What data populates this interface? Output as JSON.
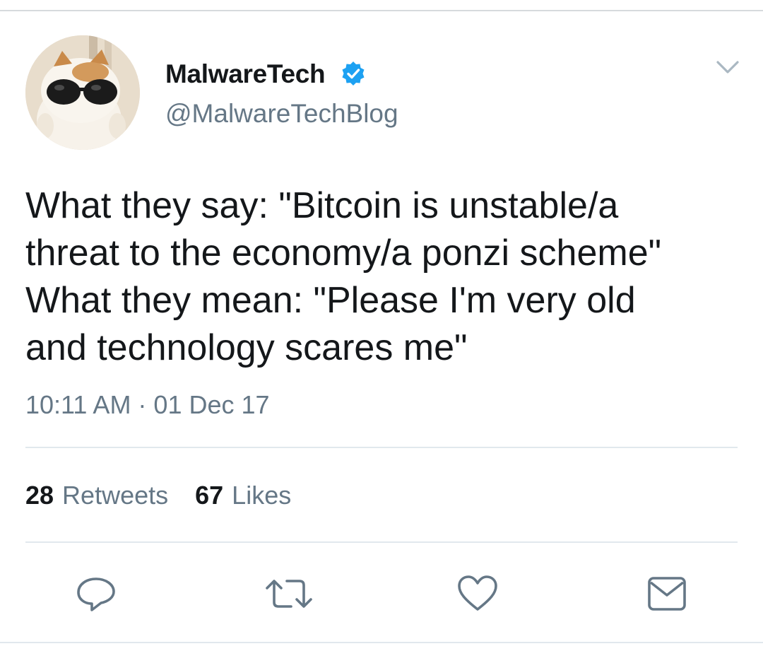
{
  "author": {
    "name": "MalwareTech",
    "handle": "@MalwareTechBlog",
    "verified": true,
    "avatar_icon": "cat-with-sunglasses-avatar"
  },
  "tweet": {
    "text": "What they say: \"Bitcoin is unstable/a\nthreat to the economy/a ponzi scheme\"\nWhat they mean: \"Please I'm very old\nand technology scares me\"",
    "timestamp": "10:11 AM · 01 Dec 17"
  },
  "stats": {
    "retweets_count": "28",
    "retweets_label": "Retweets",
    "likes_count": "67",
    "likes_label": "Likes"
  },
  "actions": [
    {
      "icon": "reply-icon"
    },
    {
      "icon": "retweet-icon"
    },
    {
      "icon": "like-icon"
    },
    {
      "icon": "share-dm-icon"
    }
  ],
  "colors": {
    "text_primary": "#14171a",
    "text_secondary": "#657786",
    "verified_blue": "#1da1f2",
    "divider": "#e1e8ed"
  }
}
